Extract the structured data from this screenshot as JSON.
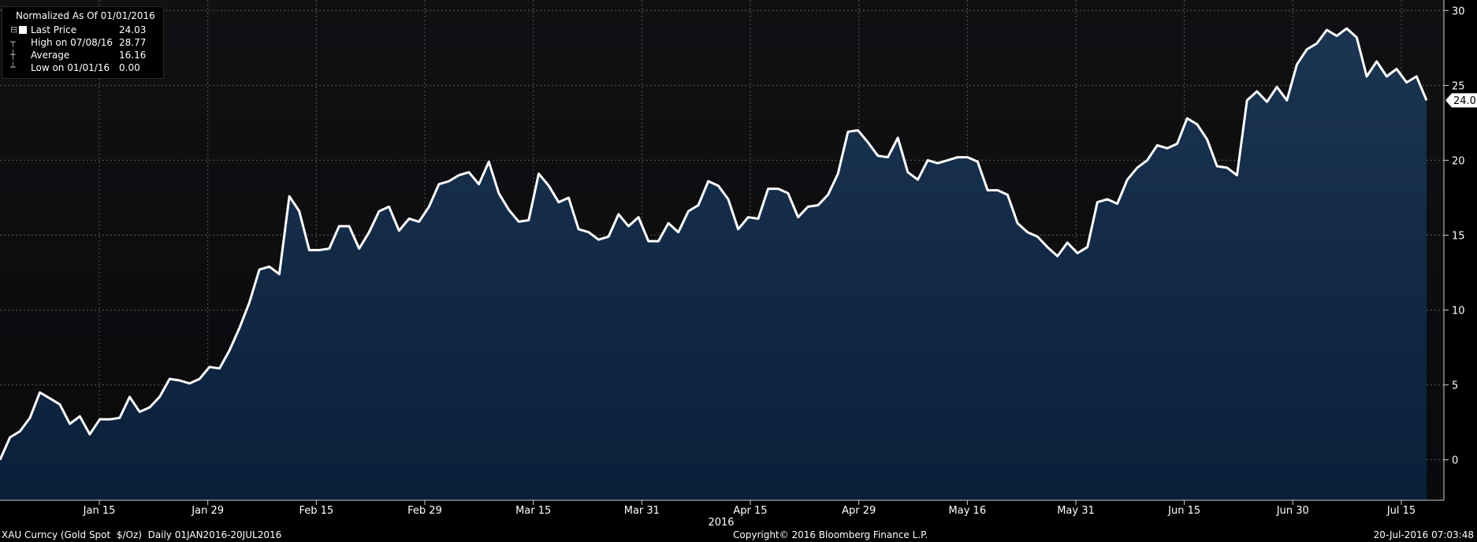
{
  "legend": {
    "title": "Normalized As Of 01/01/2016",
    "rows": [
      {
        "label": "Last Price",
        "value": "24.03"
      },
      {
        "label": "High on 07/08/16",
        "value": "28.77"
      },
      {
        "label": "Average",
        "value": "16.16"
      },
      {
        "label": "Low on 01/01/16",
        "value": "0.00"
      }
    ]
  },
  "footer": {
    "security": "XAU Curncy (Gold Spot  $/Oz)  Daily 01JAN2016-20JUL2016",
    "copyright": "Copyright© 2016 Bloomberg Finance L.P.",
    "timestamp": "20-Jul-2016 07:03:48"
  },
  "colors": {
    "background": "#000000",
    "plot_background_top": "#0c0c10",
    "area_fill_top": "#1b3552",
    "area_fill_bottom": "#0a1f3a",
    "line": "#ffffff",
    "grid": "#5a5a5a"
  },
  "chart_data": {
    "type": "area",
    "title": "Normalized As Of 01/01/2016",
    "year_label": "2016",
    "x_tick_labels": [
      "Jan 15",
      "Jan 29",
      "Feb 15",
      "Feb 29",
      "Mar 15",
      "Mar 31",
      "Apr 15",
      "Apr 29",
      "May 16",
      "May 31",
      "Jun 15",
      "Jun 30",
      "Jul 15"
    ],
    "y_ticks": [
      0,
      5,
      10,
      15,
      20,
      25,
      30
    ],
    "ylim": [
      -2.7,
      30.7
    ],
    "grid": true,
    "legend_position": "top-left",
    "last_value_label": "24.03",
    "series": [
      {
        "name": "Last Price",
        "values": [
          0.0,
          1.5,
          1.9,
          2.8,
          4.5,
          4.1,
          3.7,
          2.4,
          2.9,
          1.7,
          2.7,
          2.7,
          2.8,
          4.2,
          3.2,
          3.5,
          4.2,
          5.4,
          5.3,
          5.1,
          5.4,
          6.2,
          6.1,
          7.3,
          8.8,
          10.5,
          12.7,
          12.9,
          12.4,
          17.6,
          16.6,
          14.0,
          14.0,
          14.1,
          15.6,
          15.6,
          14.1,
          15.2,
          16.6,
          16.9,
          15.3,
          16.1,
          15.9,
          16.9,
          18.4,
          18.6,
          19.0,
          19.2,
          18.4,
          19.9,
          17.8,
          16.7,
          15.9,
          16.0,
          19.1,
          18.3,
          17.2,
          17.5,
          15.4,
          15.2,
          14.7,
          14.9,
          16.4,
          15.6,
          16.2,
          14.6,
          14.6,
          15.8,
          15.2,
          16.6,
          17.0,
          18.6,
          18.3,
          17.4,
          15.4,
          16.2,
          16.1,
          18.1,
          18.1,
          17.8,
          16.2,
          16.9,
          17.0,
          17.7,
          19.1,
          21.9,
          22.0,
          21.2,
          20.3,
          20.2,
          21.5,
          19.2,
          18.7,
          20.0,
          19.8,
          20.0,
          20.2,
          20.2,
          19.9,
          18.0,
          18.0,
          17.7,
          15.8,
          15.2,
          14.9,
          14.2,
          13.6,
          14.5,
          13.8,
          14.2,
          17.2,
          17.4,
          17.1,
          18.7,
          19.5,
          20.0,
          21.0,
          20.8,
          21.1,
          22.8,
          22.4,
          21.4,
          19.6,
          19.5,
          19.0,
          24.0,
          24.6,
          23.9,
          24.9,
          24.0,
          26.4,
          27.4,
          27.8,
          28.7,
          28.3,
          28.8,
          28.2,
          25.6,
          26.6,
          25.6,
          26.1,
          25.2,
          25.6,
          24.0
        ]
      }
    ]
  }
}
